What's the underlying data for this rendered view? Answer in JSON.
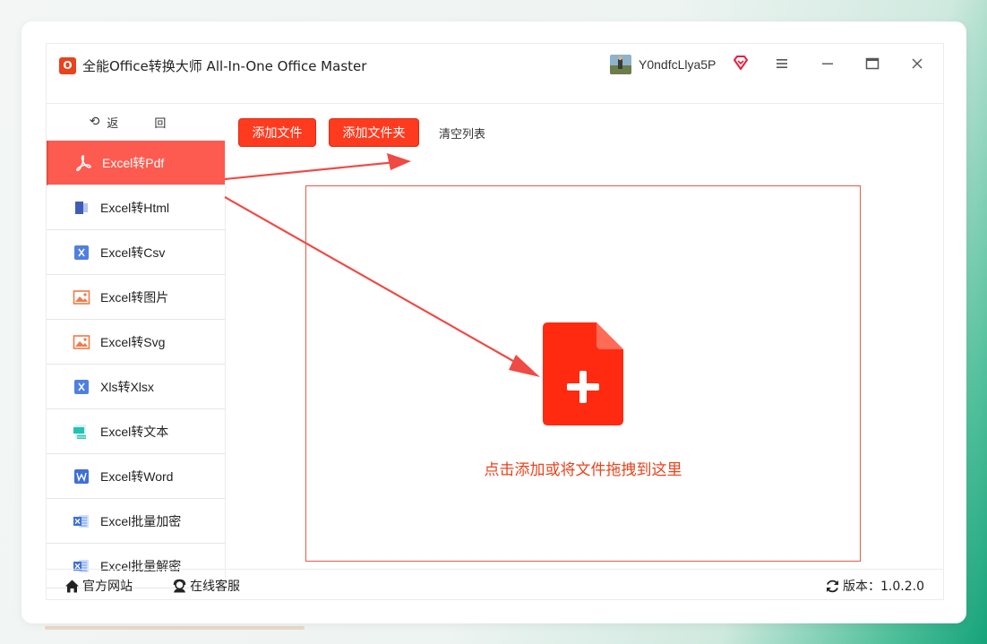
{
  "app": {
    "title": "全能Office转换大师 All-In-One Office Master",
    "icon_text": "O",
    "username": "Y0ndfcLlya5P"
  },
  "nav": {
    "back_label": "返 回"
  },
  "sidebar": {
    "items": [
      {
        "label": "Excel转Pdf",
        "icon": "pdf-icon",
        "active": true
      },
      {
        "label": "Excel转Html",
        "icon": "html-icon"
      },
      {
        "label": "Excel转Csv",
        "icon": "csv-icon"
      },
      {
        "label": "Excel转图片",
        "icon": "image-icon"
      },
      {
        "label": "Excel转Svg",
        "icon": "svg-image-icon"
      },
      {
        "label": "Xls转Xlsx",
        "icon": "xlsx-icon"
      },
      {
        "label": "Excel转文本",
        "icon": "text-icon"
      },
      {
        "label": "Excel转Word",
        "icon": "word-icon"
      },
      {
        "label": "Excel批量加密",
        "icon": "encrypt-icon"
      },
      {
        "label": "Excel批量解密",
        "icon": "decrypt-icon"
      }
    ]
  },
  "toolbar": {
    "add_file": "添加文件",
    "add_folder": "添加文件夹",
    "clear_list": "清空列表"
  },
  "dropzone": {
    "text": "点击添加或将文件拖拽到这里"
  },
  "footer": {
    "official_site": "官方网站",
    "online_service": "在线客服",
    "version": "版本：1.0.2.0"
  },
  "colors": {
    "accent": "#ff3b1f",
    "active_item": "#fd5b50",
    "drop_border": "#e85a4a"
  }
}
